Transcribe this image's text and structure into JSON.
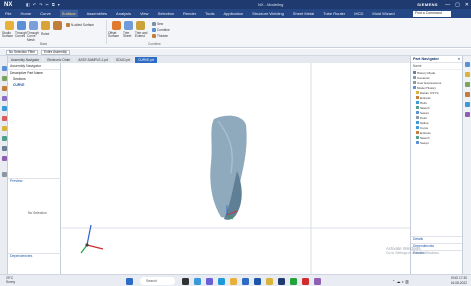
{
  "titlebar": {
    "logo": "NX",
    "quick_access": [
      "◧",
      "↶",
      "↷",
      "✂",
      "⧉",
      "▾"
    ],
    "window_title": "NX - Modeling",
    "brand": "SIEMENS",
    "controls": [
      "—",
      "▢",
      "✕"
    ]
  },
  "menubar": {
    "items": [
      "File",
      "Home",
      "Curve",
      "Surface",
      "Assemblies",
      "Analysis",
      "View",
      "Selection",
      "Render",
      "Tools",
      "Application",
      "Structure Welding",
      "Sheet Metal",
      "Tube Router",
      "MCD",
      "Mold Wizard"
    ],
    "active": "Surface",
    "search_placeholder": "Find a Command"
  },
  "ribbon": {
    "groups": [
      {
        "title": "Base",
        "buttons": [
          "Studio Surface",
          "Through Curves",
          "Through Curve Mesh",
          "Ruled",
          "N-sided Surface"
        ]
      },
      {
        "title": "Combine",
        "buttons": [
          "Offset Surface",
          "Trim Sheet",
          "Trim and Extend",
          "Sew",
          "Combine",
          "Thicken"
        ]
      }
    ]
  },
  "toolbar2": {
    "filter": "No Selection Filter",
    "scope": "Entire Assembly"
  },
  "tabs": [
    "Assembly Navigator",
    "Electronic Order",
    "ASSY-SAMPLE-1.prt",
    "SOLID.prt",
    "CURVE.prt"
  ],
  "active_tab": "CURVE.prt",
  "navigator": {
    "header": "Assembly Navigator",
    "rows": [
      "Descriptive Part Name",
      "Sections",
      "CURVE"
    ],
    "sections": [
      "Preview",
      "Dependencies"
    ],
    "no_selection": "No Selection"
  },
  "part_navigator": {
    "header": "Part Navigator",
    "column": "Name",
    "rows": [
      "History Mode",
      "Cameras",
      "User Expressions",
      "Model History",
      "Datum CSYS",
      "Extrude",
      "Helix",
      "Sketch",
      "Swept",
      "Point",
      "Spline",
      "Curve",
      "Extrude",
      "Sketch",
      "Swept"
    ],
    "sections": [
      "Details",
      "Dependencies",
      "Preview"
    ]
  },
  "watermark": {
    "line1": "Activate Windows",
    "line2": "Go to Settings to activate Windows."
  },
  "taskbar": {
    "weather_temp": "29°C",
    "weather_desc": "Sunny",
    "search": "Search",
    "language": "ENG",
    "time": "17:30",
    "date": "16-08-2022"
  },
  "colors": {
    "titlebar": "#1f3a6e",
    "menubar": "#254785",
    "accent": "#2d6cc4",
    "model": "#8fa9bd",
    "model_dark": "#5f7f97",
    "axis_x": "#d22c2c",
    "axis_y": "#23a33a",
    "axis_z": "#2d5fd0"
  }
}
